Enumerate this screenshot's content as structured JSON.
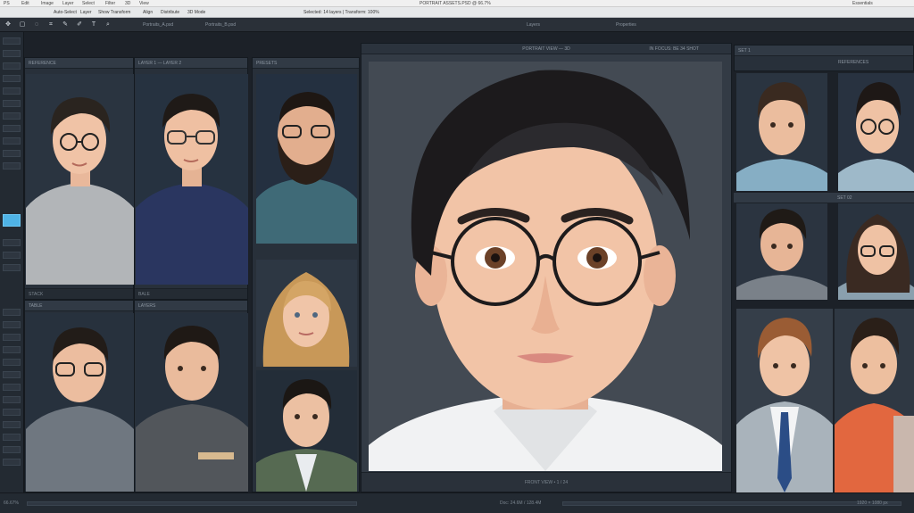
{
  "titlebar": {
    "items": [
      "PS",
      "Edit",
      "Image",
      "Layer",
      "Select",
      "Filter",
      "3D",
      "View"
    ],
    "center_title": "PORTRAIT ASSETS.PSD @ 66.7%",
    "right_text": "Essentials"
  },
  "menubar": {
    "items": [
      "Auto-Select",
      "Layer",
      "Show Transform",
      "Align",
      "Distribute",
      "3D Mode"
    ],
    "center_status": "Selected: 14 layers  |  Transform: 100%"
  },
  "toolbar": {
    "tabs": [
      "Portraits_A.psd",
      "Portraits_B.psd",
      "Layers",
      "Properties"
    ],
    "icons": [
      "move-icon",
      "marquee-icon",
      "lasso-icon",
      "crop-icon",
      "eyedropper-icon",
      "brush-icon",
      "text-icon",
      "zoom-icon"
    ]
  },
  "tools": {
    "active_index": 11
  },
  "panels": {
    "left_top_header": "REFERENCE",
    "left_top_tab2": "LAYER 1 — LAYER 2",
    "left_top_tab3": "PRESETS",
    "left_bottom_header": "TABLE",
    "left_bottom_header2": "LAYERS",
    "left_top_footer_1": "STACK",
    "left_top_footer_2": "BALE",
    "right_header": "SET 1",
    "right_header2": "REFERENCES",
    "right_tab_label": "SET 02",
    "viewer_title": "PORTRAIT VIEW — 3D",
    "viewer_right": "IN FOCUS: BE 34 SHOT",
    "viewer_footer": "FRONT VIEW  •  1 / 24"
  },
  "statusbar": {
    "left": "66.67%",
    "center": "Doc: 24.6M / 128.4M",
    "right": "1920 × 1080 px"
  },
  "portraits": {
    "grid": [
      {
        "name": "teen-glasses-grey",
        "caption": ""
      },
      {
        "name": "young-man-glasses-navy",
        "caption": ""
      },
      {
        "name": "bearded-man-glasses-teal",
        "caption": ""
      },
      {
        "name": "boy-glasses-grey-shirt",
        "caption": ""
      },
      {
        "name": "young-man-dark-shirt",
        "caption": ""
      },
      {
        "name": "woman-blonde-wavy",
        "caption": ""
      },
      {
        "name": "boy-green-jacket",
        "caption": ""
      }
    ],
    "main": "young-woman-round-glasses",
    "right": [
      {
        "name": "boy-light-blue"
      },
      {
        "name": "boy-glasses-blue"
      },
      {
        "name": "boy-grey-collar"
      },
      {
        "name": "girl-glasses-plaid"
      },
      {
        "name": "boy-suit-tie"
      },
      {
        "name": "boy-orange-plaid"
      }
    ]
  },
  "colors": {
    "accent": "#4fb3e6",
    "warning": "#e8913a",
    "panel": "#28303a",
    "background": "#1c2128"
  }
}
